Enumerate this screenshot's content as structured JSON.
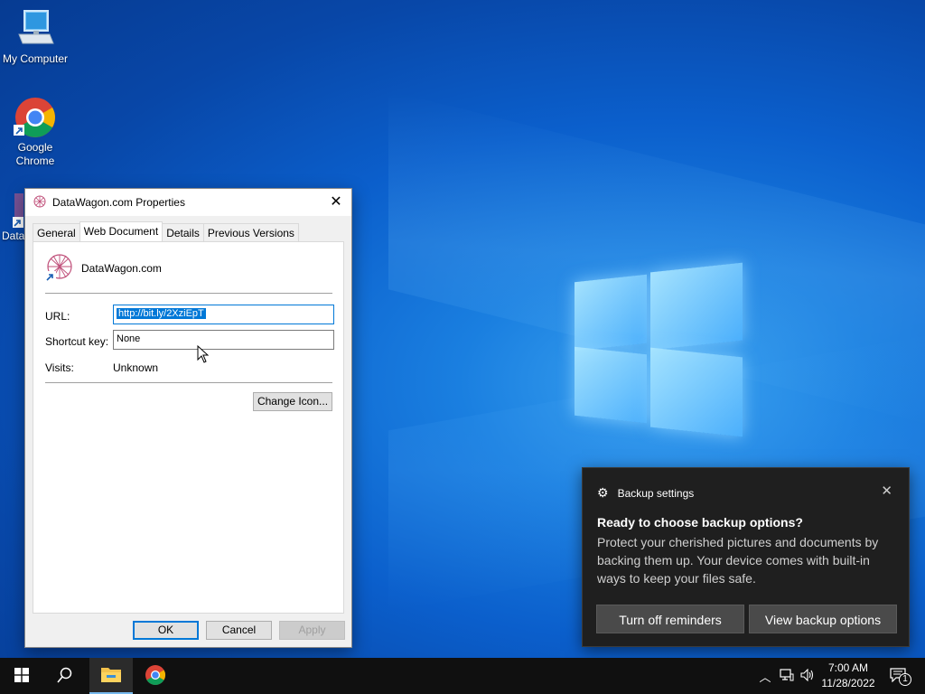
{
  "desktop": {
    "icons": [
      {
        "label": "My Computer"
      },
      {
        "label": "Google\nChrome"
      },
      {
        "label": "Data"
      }
    ]
  },
  "dialog": {
    "title": "DataWagon.com Properties",
    "tabs": [
      "General",
      "Web Document",
      "Details",
      "Previous Versions"
    ],
    "active_tab": "Web Document",
    "file_name": "DataWagon.com",
    "url_label": "URL:",
    "url_value": "http://bit.ly/2XziEpT",
    "shortcut_label": "Shortcut key:",
    "shortcut_value": "None",
    "visits_label": "Visits:",
    "visits_value": "Unknown",
    "change_icon": "Change Icon...",
    "ok": "OK",
    "cancel": "Cancel",
    "apply": "Apply"
  },
  "toast": {
    "app": "Backup settings",
    "heading": "Ready to choose backup options?",
    "body": "Protect your cherished pictures and documents by backing them up. Your device comes with built-in ways to keep your files safe.",
    "btn_off": "Turn off reminders",
    "btn_view": "View backup options"
  },
  "taskbar": {
    "time": "7:00 AM",
    "date": "11/28/2022",
    "notification_count": "1"
  },
  "colors": {
    "accent": "#0078d7",
    "toast_bg": "#1f1f1f",
    "taskbar_bg": "#101010"
  }
}
